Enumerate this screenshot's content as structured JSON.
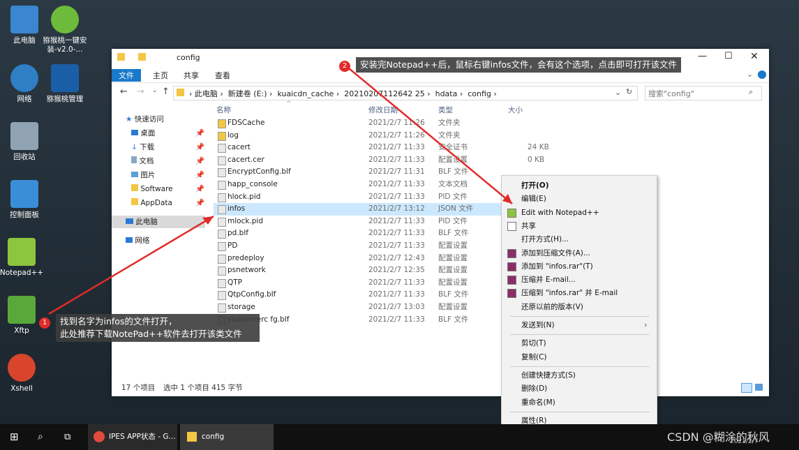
{
  "desktop_icons": [
    {
      "label": "此电脑",
      "icon": "computer-icon"
    },
    {
      "label": "猕猴桃一键安装-v2.0-...",
      "icon": "kiwi-app-icon"
    },
    {
      "label": "网络",
      "icon": "network-icon"
    },
    {
      "label": "猕猴桃管理",
      "icon": "kiwi-manage-icon"
    },
    {
      "label": "回收站",
      "icon": "recycle-bin-icon"
    },
    {
      "label": "控制面板",
      "icon": "control-panel-icon"
    },
    {
      "label": "Notepad++",
      "icon": "notepad-plus-icon"
    },
    {
      "label": "Xftp",
      "icon": "xftp-icon"
    },
    {
      "label": "Xshell",
      "icon": "xshell-icon"
    }
  ],
  "window": {
    "title": "config",
    "ribbon_tabs": [
      "文件",
      "主页",
      "共享",
      "查看"
    ],
    "breadcrumb": [
      "此电脑",
      "新建卷 (E:)",
      "kuaicdn_cache",
      "20210207112642 25",
      "hdata",
      "config"
    ],
    "search_placeholder": "搜索\"config\"",
    "nav": {
      "quick_access": "快速访问",
      "items": [
        "桌面",
        "下载",
        "文档",
        "图片",
        "Software",
        "AppData"
      ],
      "this_pc": "此电脑",
      "network": "网络"
    },
    "columns": {
      "name": "名称",
      "date": "修改日期",
      "type": "类型",
      "size": "大小"
    },
    "files": [
      {
        "name": "FDSCache",
        "date": "2021/2/7 11:26",
        "type": "文件夹",
        "size": ""
      },
      {
        "name": "log",
        "date": "2021/2/7 11:26",
        "type": "文件夹",
        "size": ""
      },
      {
        "name": "cacert",
        "date": "2021/2/7 11:33",
        "type": "安全证书",
        "size": "24 KB"
      },
      {
        "name": "cacert.cer",
        "date": "2021/2/7 11:33",
        "type": "配置设置",
        "size": "0 KB"
      },
      {
        "name": "EncryptConfig.blf",
        "date": "2021/2/7 11:31",
        "type": "BLF 文件",
        "size": ""
      },
      {
        "name": "happ_console",
        "date": "2021/2/7 11:33",
        "type": "文本文档",
        "size": ""
      },
      {
        "name": "hlock.pid",
        "date": "2021/2/7 11:33",
        "type": "PID 文件",
        "size": ""
      },
      {
        "name": "infos",
        "date": "2021/2/7 13:12",
        "type": "JSON 文件",
        "size": ""
      },
      {
        "name": "mlock.pid",
        "date": "2021/2/7 11:33",
        "type": "PID 文件",
        "size": ""
      },
      {
        "name": "pd.blf",
        "date": "2021/2/7 11:33",
        "type": "BLF 文件",
        "size": ""
      },
      {
        "name": "PD",
        "date": "2021/2/7 11:33",
        "type": "配置设置",
        "size": ""
      },
      {
        "name": "predeploy",
        "date": "2021/2/7 12:43",
        "type": "配置设置",
        "size": ""
      },
      {
        "name": "psnetwork",
        "date": "2021/2/7 12:35",
        "type": "配置设置",
        "size": ""
      },
      {
        "name": "QTP",
        "date": "2021/2/7 11:33",
        "type": "配置设置",
        "size": ""
      },
      {
        "name": "QtpConfig.blf",
        "date": "2021/2/7 11:33",
        "type": "BLF 文件",
        "size": ""
      },
      {
        "name": "storage",
        "date": "2021/2/7 13:03",
        "type": "配置设置",
        "size": ""
      },
      {
        "name": "vodserverc fg.blf",
        "date": "2021/2/7 11:33",
        "type": "BLF 文件",
        "size": ""
      }
    ],
    "status": {
      "count": "17 个项目",
      "selected": "选中 1 个项目  415 字节"
    }
  },
  "context_menu": {
    "groups": [
      [
        "打开(O)",
        "编辑(E)",
        "Edit with Notepad++",
        "共享",
        "打开方式(H)...",
        "添加到压缩文件(A)...",
        "添加到 \"infos.rar\"(T)",
        "压缩并 E-mail...",
        "压缩到 \"infos.rar\" 并 E-mail",
        "还原以前的版本(V)"
      ],
      [
        "发送到(N)"
      ],
      [
        "剪切(T)",
        "复制(C)"
      ],
      [
        "创建快捷方式(S)",
        "删除(D)",
        "重命名(M)"
      ],
      [
        "属性(R)"
      ]
    ]
  },
  "callouts": {
    "one": {
      "badge": "1",
      "text": "找到名字为infos的文件打开，\n此处推荐下载NotePad++软件去打开该类文件"
    },
    "two": {
      "badge": "2",
      "text": "安装完Notepad++后，鼠标右键infos文件，会有这个选项，点击即可打开该文件"
    }
  },
  "taskbar": {
    "chrome_label": "IPES APP状态 - G...",
    "explorer_label": "config",
    "watermark": "CSDN @糊涂的秋风",
    "date": "2021/2/7"
  },
  "colors": {
    "accent": "#1979ca",
    "selection": "#cce8ff",
    "annotation": "#e12b2b"
  }
}
